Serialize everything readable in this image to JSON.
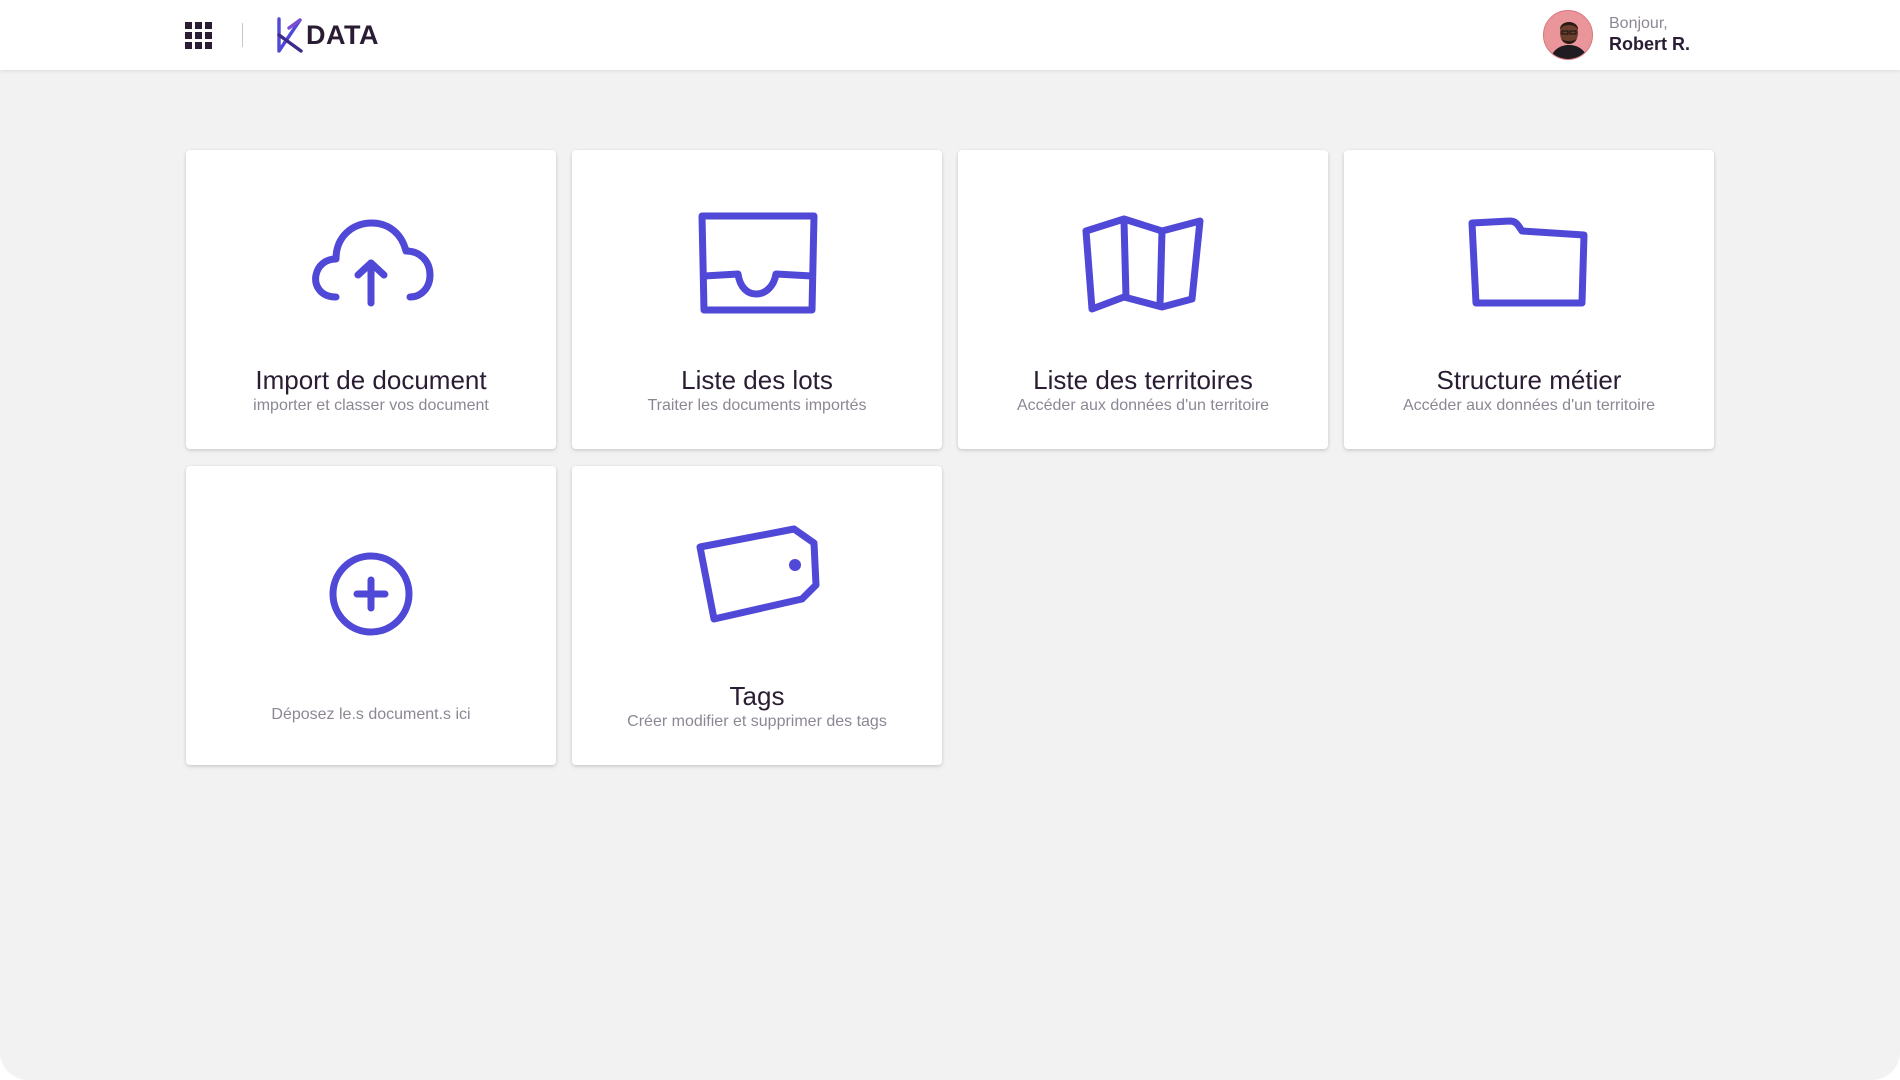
{
  "header": {
    "logo_text": "DATA",
    "greeting": "Bonjour,",
    "username": "Robert R."
  },
  "colors": {
    "accent": "#5048d6",
    "text_dark": "#2a1d33",
    "text_muted": "#8d8794",
    "background": "#f2f2f2"
  },
  "cards": [
    {
      "icon": "cloud-upload-icon",
      "title": "Import de document",
      "subtitle": "importer et classer vos document"
    },
    {
      "icon": "inbox-icon",
      "title": "Liste des lots",
      "subtitle": "Traiter les documents importés"
    },
    {
      "icon": "map-icon",
      "title": "Liste des territoires",
      "subtitle": "Accéder aux données d'un territoire"
    },
    {
      "icon": "folder-icon",
      "title": "Structure métier",
      "subtitle": "Accéder aux données d'un territoire"
    },
    {
      "icon": "plus-circle-icon",
      "title": "",
      "subtitle": "Déposez le.s document.s ici"
    },
    {
      "icon": "tag-icon",
      "title": "Tags",
      "subtitle": "Créer modifier et supprimer des tags"
    }
  ]
}
